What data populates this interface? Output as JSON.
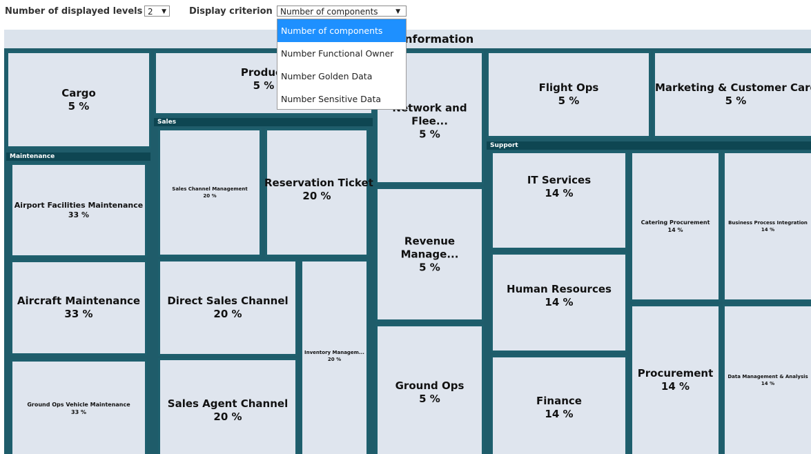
{
  "toolbar": {
    "levels_label": "Number of displayed levels",
    "levels_value": "2",
    "criterion_label": "Display criterion",
    "criterion_value": "Number of components",
    "dropdown_arrow": "▼",
    "criterion_options": [
      "Number of components",
      "Number Functional Owner",
      "Number Golden Data",
      "Number Sensitive Data"
    ]
  },
  "treemap": {
    "title": "Business Information",
    "groups": {
      "maintenance": "Maintenance",
      "sales": "Sales",
      "support": "Support"
    },
    "cells": {
      "cargo": {
        "label": "Cargo",
        "value": "5 %"
      },
      "product": {
        "label": "Product",
        "value": "5 %"
      },
      "network": {
        "label": "Network and Flee...",
        "value": "5 %"
      },
      "flight_ops": {
        "label": "Flight Ops",
        "value": "5 %"
      },
      "marketing": {
        "label": "Marketing & Customer Care",
        "value": "5 %"
      },
      "airport_facilities": {
        "label": "Airport Facilities Maintenance",
        "value": "33 %"
      },
      "aircraft_maintenance": {
        "label": "Aircraft Maintenance",
        "value": "33 %"
      },
      "ground_ops_vehicle": {
        "label": "Ground Ops Vehicle Maintenance",
        "value": "33 %"
      },
      "sales_channel_mgmt": {
        "label": "Sales Channel Management",
        "value": "20 %"
      },
      "reservation_ticket": {
        "label": "Reservation Ticket",
        "value": "20 %"
      },
      "direct_sales": {
        "label": "Direct Sales Channel",
        "value": "20 %"
      },
      "sales_agent": {
        "label": "Sales Agent Channel",
        "value": "20 %"
      },
      "inventory_mgmt": {
        "label": "Inventory Managem...",
        "value": "20 %"
      },
      "revenue_mgmt": {
        "label": "Revenue Manage...",
        "value": "5 %"
      },
      "ground_ops": {
        "label": "Ground Ops",
        "value": "5 %"
      },
      "it_services": {
        "label": "IT Services",
        "value": "14 %"
      },
      "human_resources": {
        "label": "Human Resources",
        "value": "14 %"
      },
      "finance": {
        "label": "Finance",
        "value": "14 %"
      },
      "catering": {
        "label": "Catering Procurement",
        "value": "14 %"
      },
      "bpi": {
        "label": "Business Process Integration",
        "value": "14 %"
      },
      "procurement": {
        "label": "Procurement",
        "value": "14 %"
      },
      "data_mgmt": {
        "label": "Data Management & Analysis",
        "value": "14 %"
      }
    }
  }
}
